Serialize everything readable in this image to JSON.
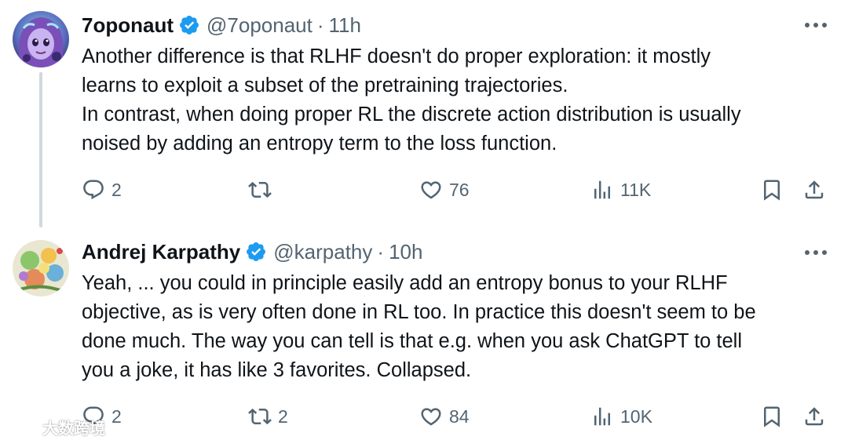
{
  "tweets": [
    {
      "display_name": "7oponaut",
      "handle": "@7oponaut",
      "separator": "·",
      "time": "11h",
      "lines": [
        "Another difference is that RLHF doesn't do proper exploration: it mostly",
        "learns to exploit a subset of the pretraining trajectories.",
        "In contrast, when doing proper RL the discrete action distribution is usually",
        "noised by adding an entropy term to the loss function."
      ],
      "replies": "2",
      "retweets": "",
      "likes": "76",
      "views": "11K"
    },
    {
      "display_name": "Andrej Karpathy",
      "handle": "@karpathy",
      "separator": "·",
      "time": "10h",
      "lines": [
        "Yeah, ... you could in principle easily add an entropy bonus to your RLHF",
        "objective, as is very often done in RL too. In practice this doesn't seem to be",
        "done much. The way you can tell is that e.g. when you ask ChatGPT to tell",
        "you a joke, it has like 3 favorites. Collapsed."
      ],
      "replies": "2",
      "retweets": "2",
      "likes": "84",
      "views": "10K"
    }
  ],
  "watermark": {
    "text": "大数跨境"
  },
  "colors": {
    "text_primary": "#0f1419",
    "text_secondary": "#536471",
    "verified_blue": "#1d9bf0",
    "thread_line": "#cfd9de"
  },
  "icons": {
    "reply": "reply-icon",
    "retweet": "retweet-icon",
    "like": "heart-icon",
    "views": "views-icon",
    "bookmark": "bookmark-icon",
    "share": "share-icon",
    "more": "more-icon",
    "verified": "verified-badge-icon"
  }
}
